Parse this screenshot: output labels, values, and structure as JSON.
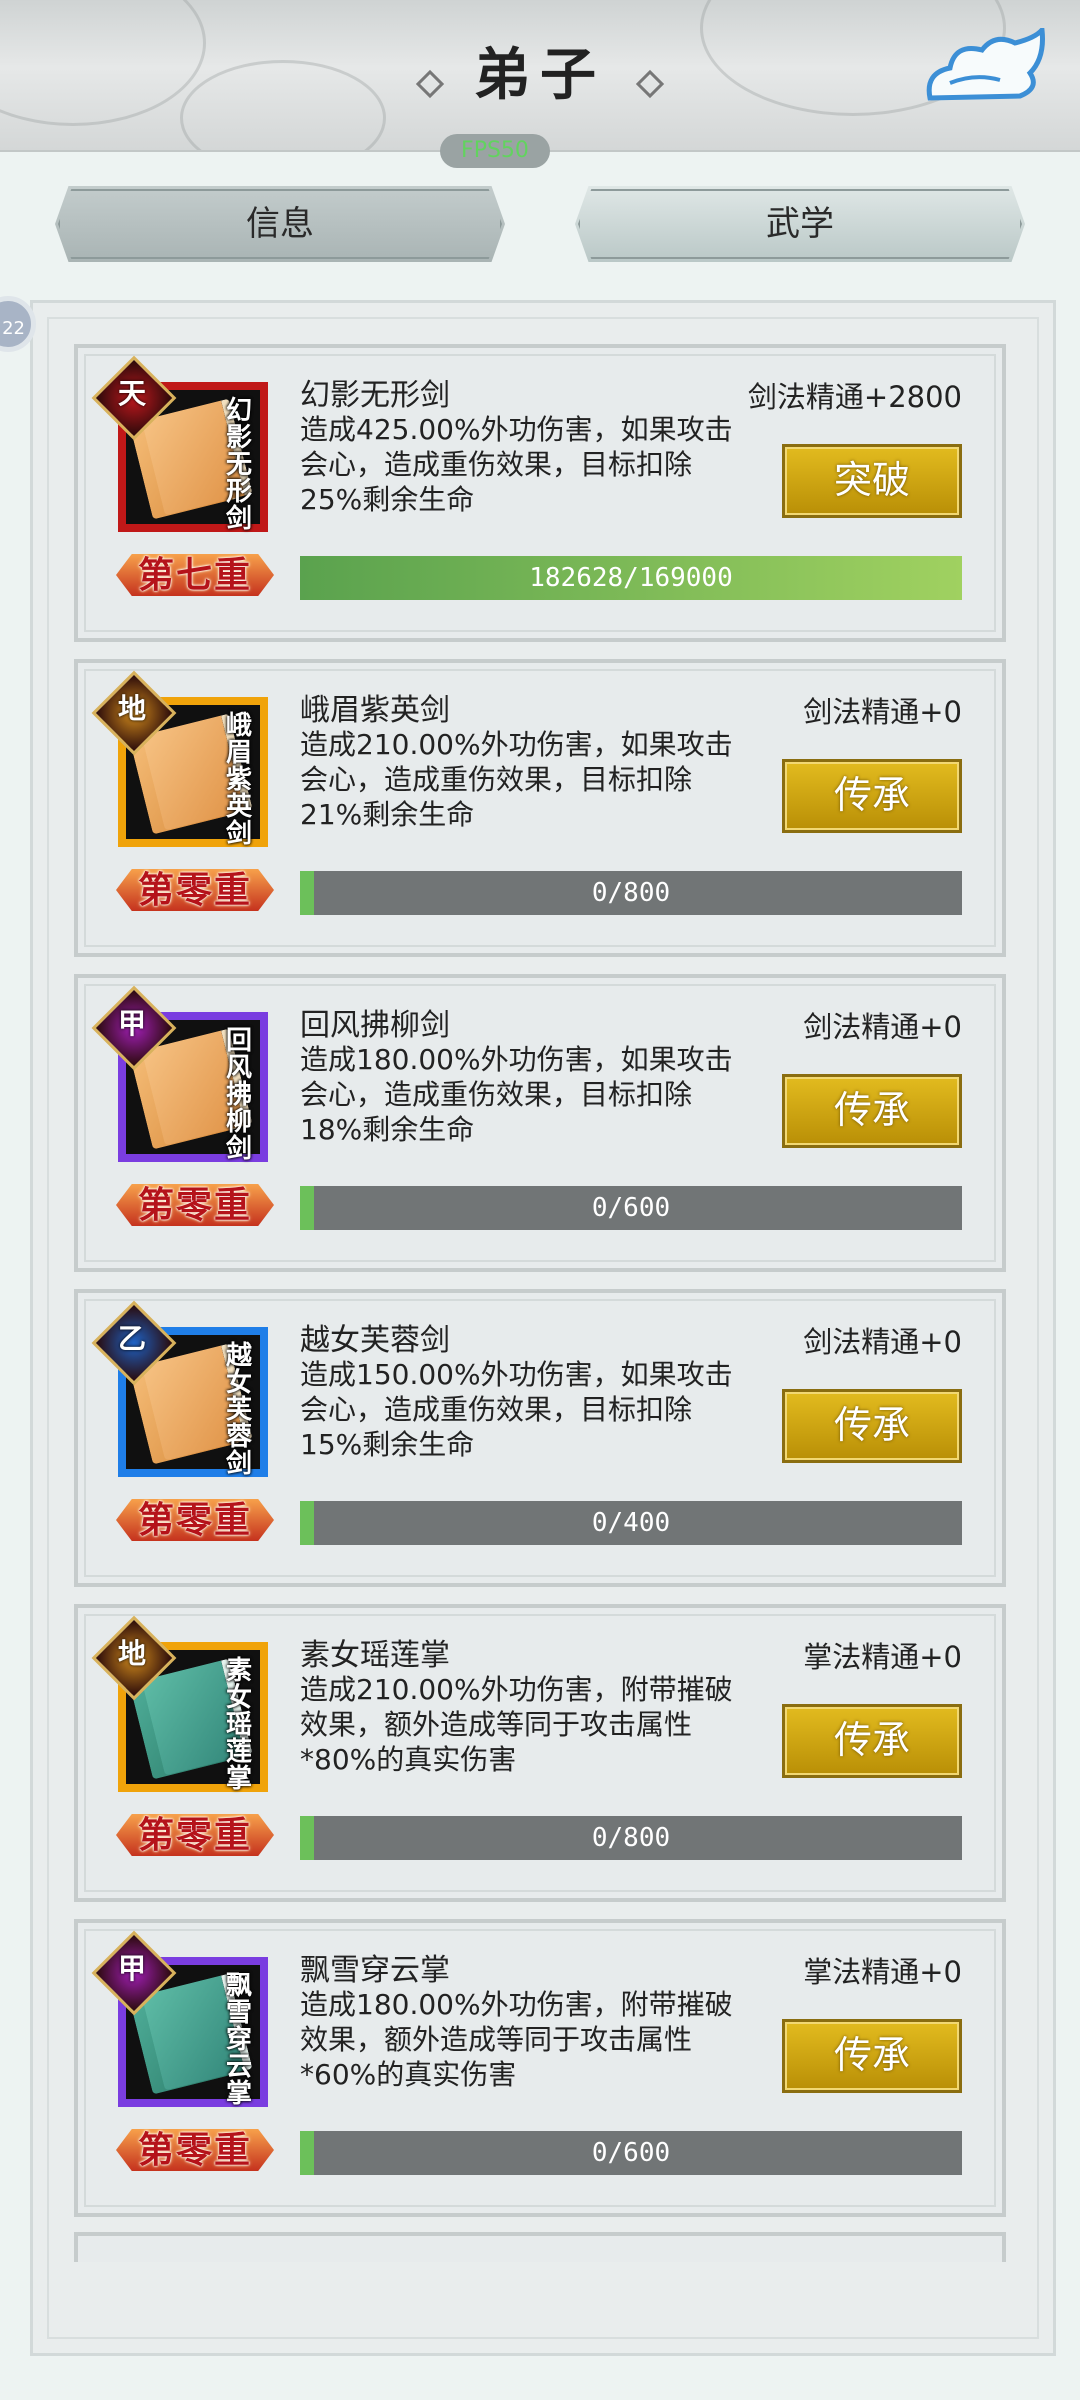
{
  "header": {
    "title": "弟子",
    "fps": "FPS50"
  },
  "tabs": [
    {
      "label": "信息",
      "active": false
    },
    {
      "label": "武学",
      "active": true
    }
  ],
  "side_badge": "22",
  "skills": [
    {
      "grade": "天",
      "grade_color": "#c0181e",
      "frame": "#c01818",
      "book": "orange",
      "icon_text": "幻影无形剑",
      "name": "幻影无形剑",
      "desc": "造成425.00%外功伤害，如果攻击会心，造成重伤效果，目标扣除25%剩余生命",
      "mastery": "剑法精通+2800",
      "action": "突破",
      "level": "第七重",
      "progress_text": "182628/169000",
      "progress": 1.0
    },
    {
      "grade": "地",
      "grade_color": "#d08a1c",
      "frame": "#f0a30a",
      "book": "orange",
      "icon_text": "峨眉紫英剑",
      "name": "峨眉紫英剑",
      "desc": "造成210.00%外功伤害，如果攻击会心，造成重伤效果，目标扣除21%剩余生命",
      "mastery": "剑法精通+0",
      "action": "传承",
      "level": "第零重",
      "progress_text": "0/800",
      "progress": 0.0
    },
    {
      "grade": "甲",
      "grade_color": "#a21fb8",
      "frame": "#7a3de0",
      "book": "orange",
      "icon_text": "回风拂柳剑",
      "name": "回风拂柳剑",
      "desc": "造成180.00%外功伤害，如果攻击会心，造成重伤效果，目标扣除18%剩余生命",
      "mastery": "剑法精通+0",
      "action": "传承",
      "level": "第零重",
      "progress_text": "0/600",
      "progress": 0.0
    },
    {
      "grade": "乙",
      "grade_color": "#1f63c6",
      "frame": "#1f7ee8",
      "book": "orange",
      "icon_text": "越女芙蓉剑",
      "name": "越女芙蓉剑",
      "desc": "造成150.00%外功伤害，如果攻击会心，造成重伤效果，目标扣除15%剩余生命",
      "mastery": "剑法精通+0",
      "action": "传承",
      "level": "第零重",
      "progress_text": "0/400",
      "progress": 0.0
    },
    {
      "grade": "地",
      "grade_color": "#d08a1c",
      "frame": "#f0a30a",
      "book": "green",
      "icon_text": "素女瑶莲掌",
      "name": "素女瑶莲掌",
      "desc": "造成210.00%外功伤害，附带摧破效果，额外造成等同于攻击属性*80%的真实伤害",
      "mastery": "掌法精通+0",
      "action": "传承",
      "level": "第零重",
      "progress_text": "0/800",
      "progress": 0.0
    },
    {
      "grade": "甲",
      "grade_color": "#a21fb8",
      "frame": "#7a3de0",
      "book": "green",
      "icon_text": "飘雪穿云掌",
      "name": "飘雪穿云掌",
      "desc": "造成180.00%外功伤害，附带摧破效果，额外造成等同于攻击属性*60%的真实伤害",
      "mastery": "掌法精通+0",
      "action": "传承",
      "level": "第零重",
      "progress_text": "0/600",
      "progress": 0.0
    }
  ]
}
